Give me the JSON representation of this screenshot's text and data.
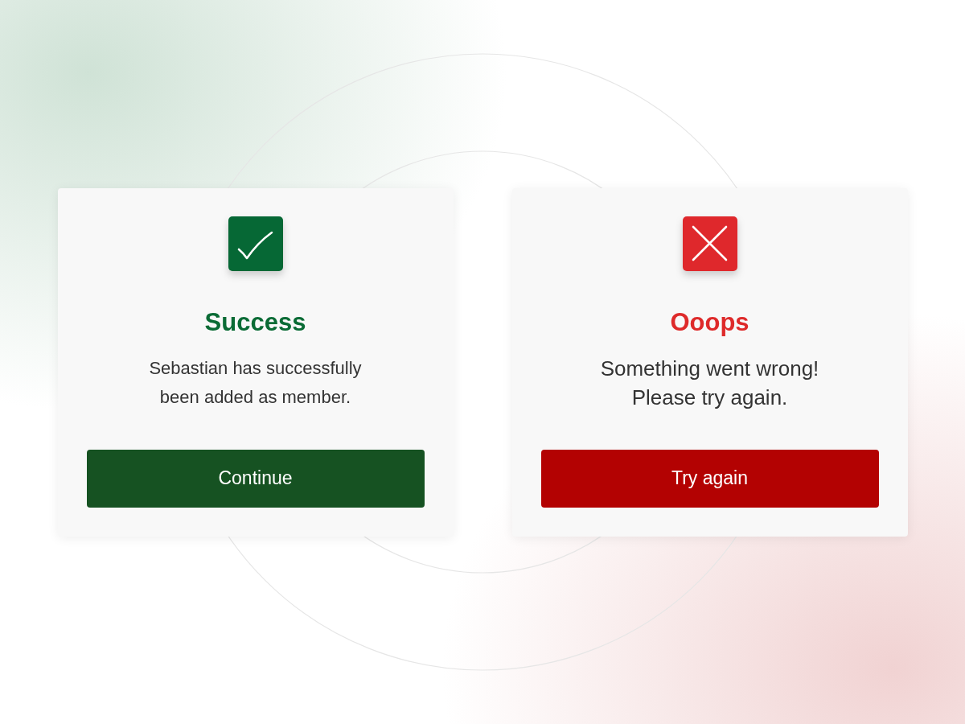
{
  "cards": [
    {
      "kind": "success",
      "title": "Success",
      "message": "Sebastian has successfully\nbeen added as member.",
      "button": "Continue"
    },
    {
      "kind": "error",
      "title": "Ooops",
      "message": "Something went wrong!\nPlease try again.",
      "button": "Try again"
    }
  ]
}
